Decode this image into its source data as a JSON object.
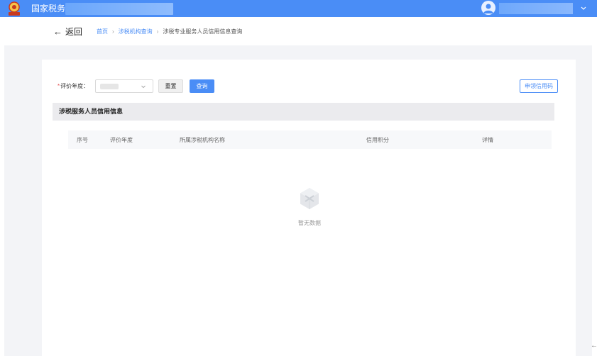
{
  "header": {
    "site_title": "国家税务"
  },
  "breadcrumb": {
    "back_label": "返回",
    "items": [
      "首页",
      "涉税机构查询",
      "涉税专业服务人员信用信息查询"
    ]
  },
  "filter": {
    "year_label": "评价年度",
    "year_required_mark": "*",
    "year_label_colon": "：",
    "reset_label": "重置",
    "query_label": "查询",
    "apply_credit_label": "申领信用码"
  },
  "section": {
    "title": "涉税服务人员信用信息"
  },
  "table": {
    "columns": [
      "序号",
      "评价年度",
      "所属涉税机构名称",
      "信用积分",
      "详情"
    ],
    "empty_text": "暂无数据"
  },
  "colors": {
    "primary": "#4a8df6",
    "required": "#e34d4d",
    "panel_bg": "#f3f4f7"
  }
}
